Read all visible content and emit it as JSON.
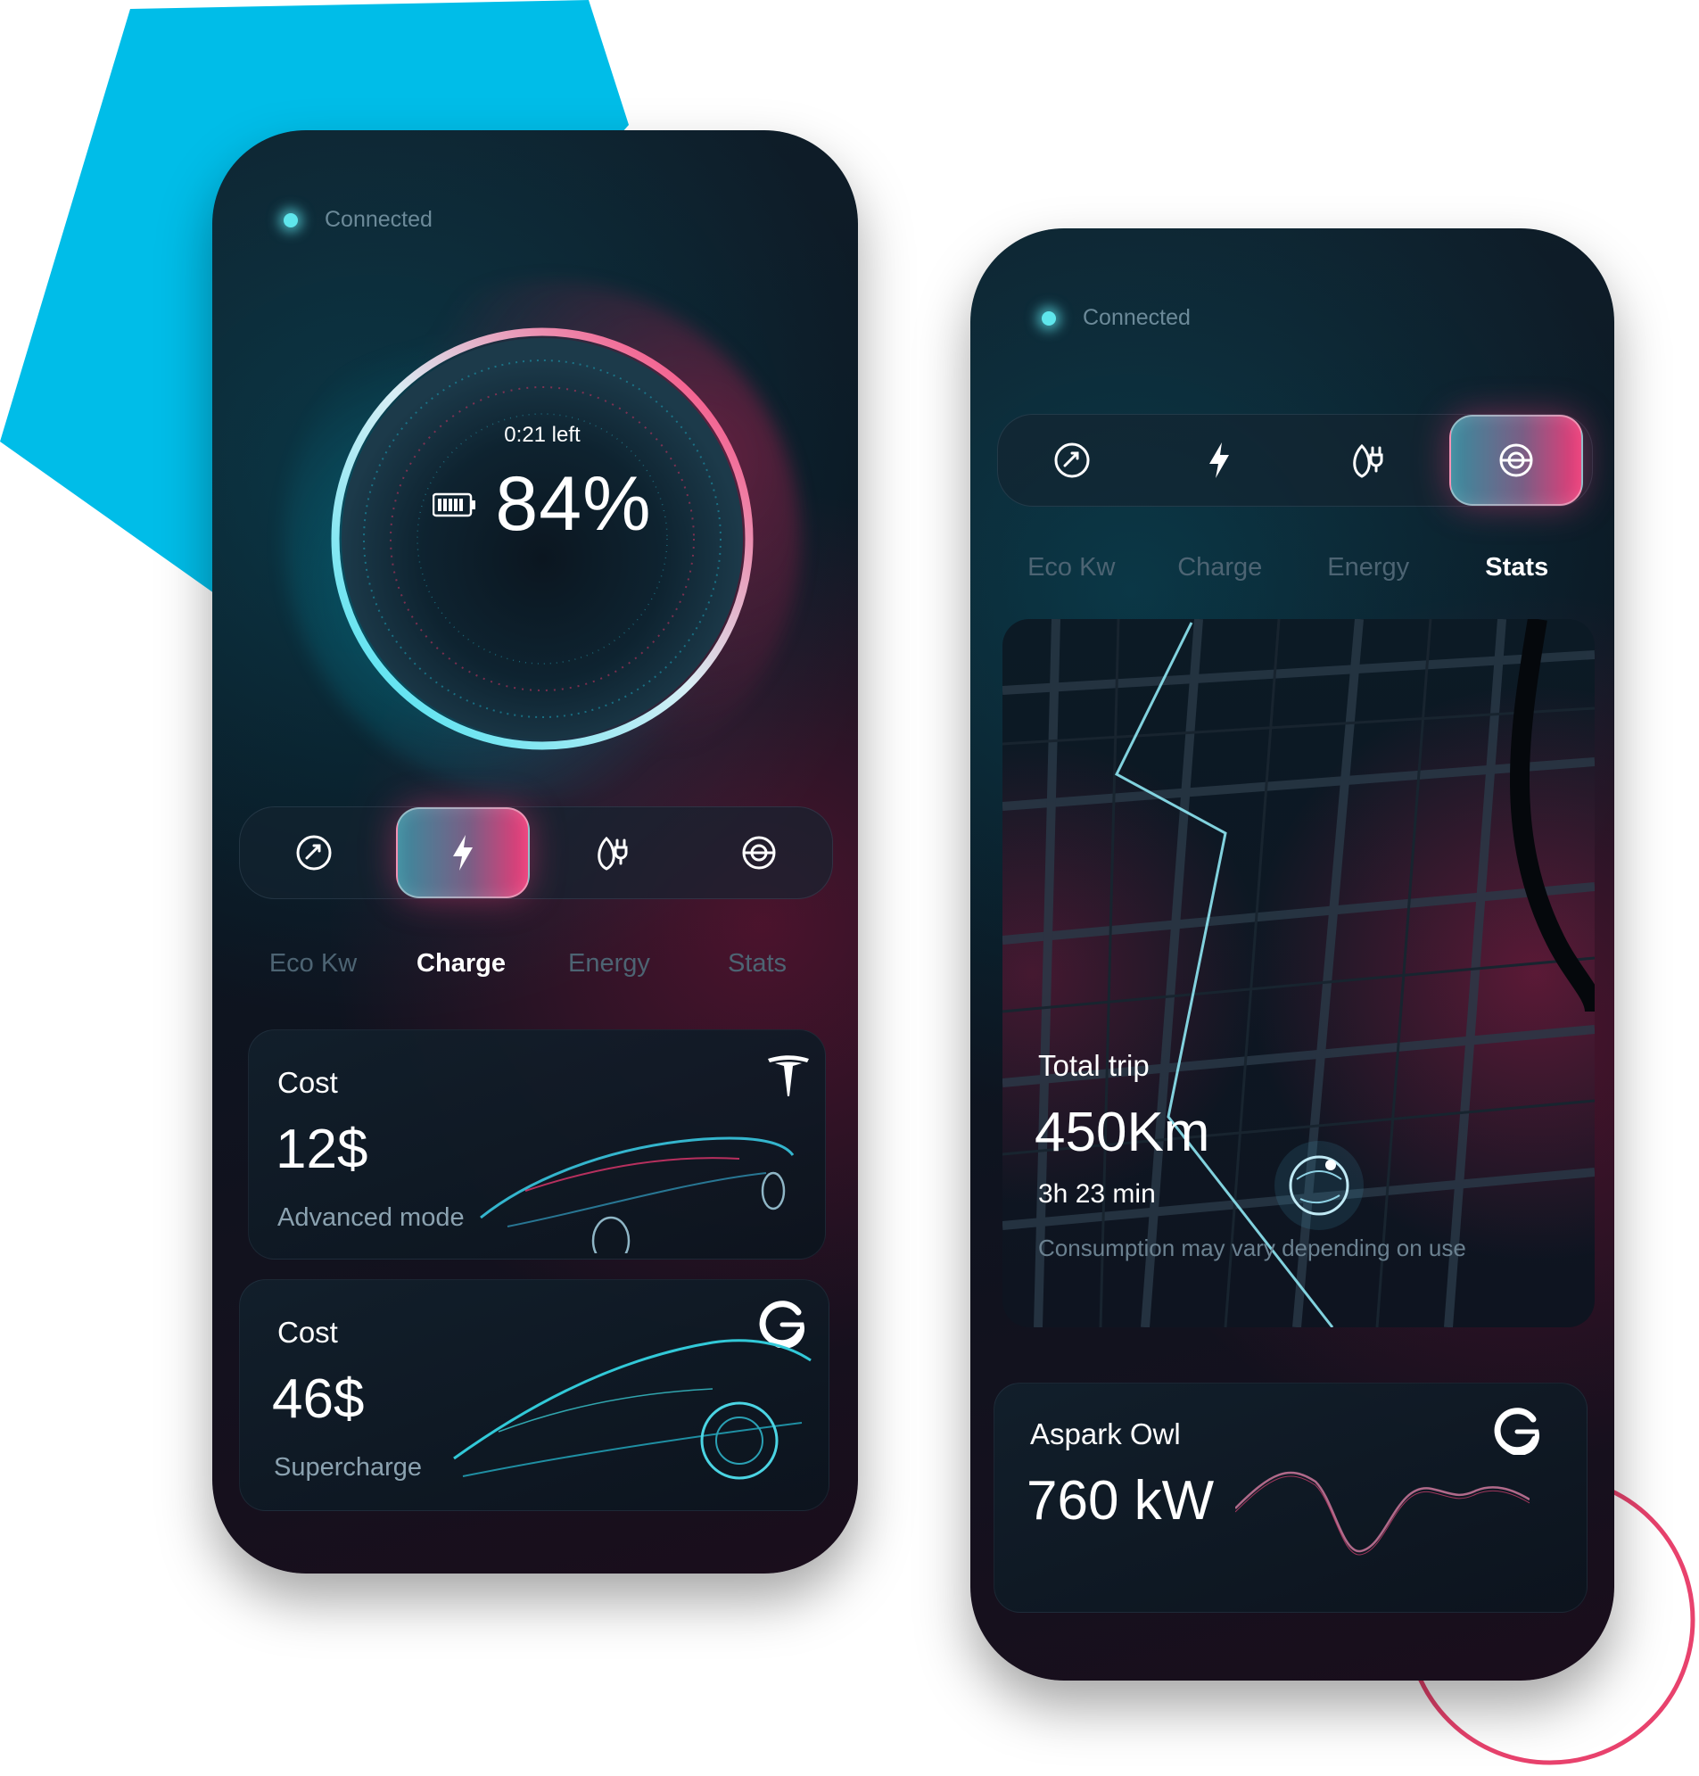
{
  "colors": {
    "accent_cyan": "#00bde8",
    "accent_pink": "#ec3a77",
    "ring_pink": "#e8426d",
    "dot": "#5fe6ec"
  },
  "left_phone": {
    "status": "Connected",
    "charge": {
      "time_left": "0:21 left",
      "percent_label": "84%",
      "level_percent": 84
    },
    "tabs": [
      {
        "icon": "eco-gauge-icon",
        "label": "Eco Kw",
        "active": false
      },
      {
        "icon": "lightning-icon",
        "label": "Charge",
        "active": true
      },
      {
        "icon": "leaf-plug-icon",
        "label": "Energy",
        "active": false
      },
      {
        "icon": "stats-dial-icon",
        "label": "Stats",
        "active": false
      }
    ],
    "cards": [
      {
        "title": "Cost",
        "value": "12$",
        "subtitle": "Advanced mode",
        "brand_icon": "tesla-logo-icon"
      },
      {
        "title": "Cost",
        "value": "46$",
        "subtitle": "Supercharge",
        "brand_icon": "aspark-logo-icon"
      }
    ]
  },
  "right_phone": {
    "status": "Connected",
    "tabs": [
      {
        "icon": "eco-gauge-icon",
        "label": "Eco Kw",
        "active": false
      },
      {
        "icon": "lightning-icon",
        "label": "Charge",
        "active": false
      },
      {
        "icon": "leaf-plug-icon",
        "label": "Energy",
        "active": false
      },
      {
        "icon": "stats-dial-icon",
        "label": "Stats",
        "active": true
      }
    ],
    "trip": {
      "title": "Total trip",
      "distance": "450Km",
      "duration": "3h 23 min",
      "note": "Consumption may vary depending on use"
    },
    "power_card": {
      "title": "Aspark Owl",
      "value": "760 kW",
      "brand_icon": "aspark-logo-icon"
    }
  }
}
